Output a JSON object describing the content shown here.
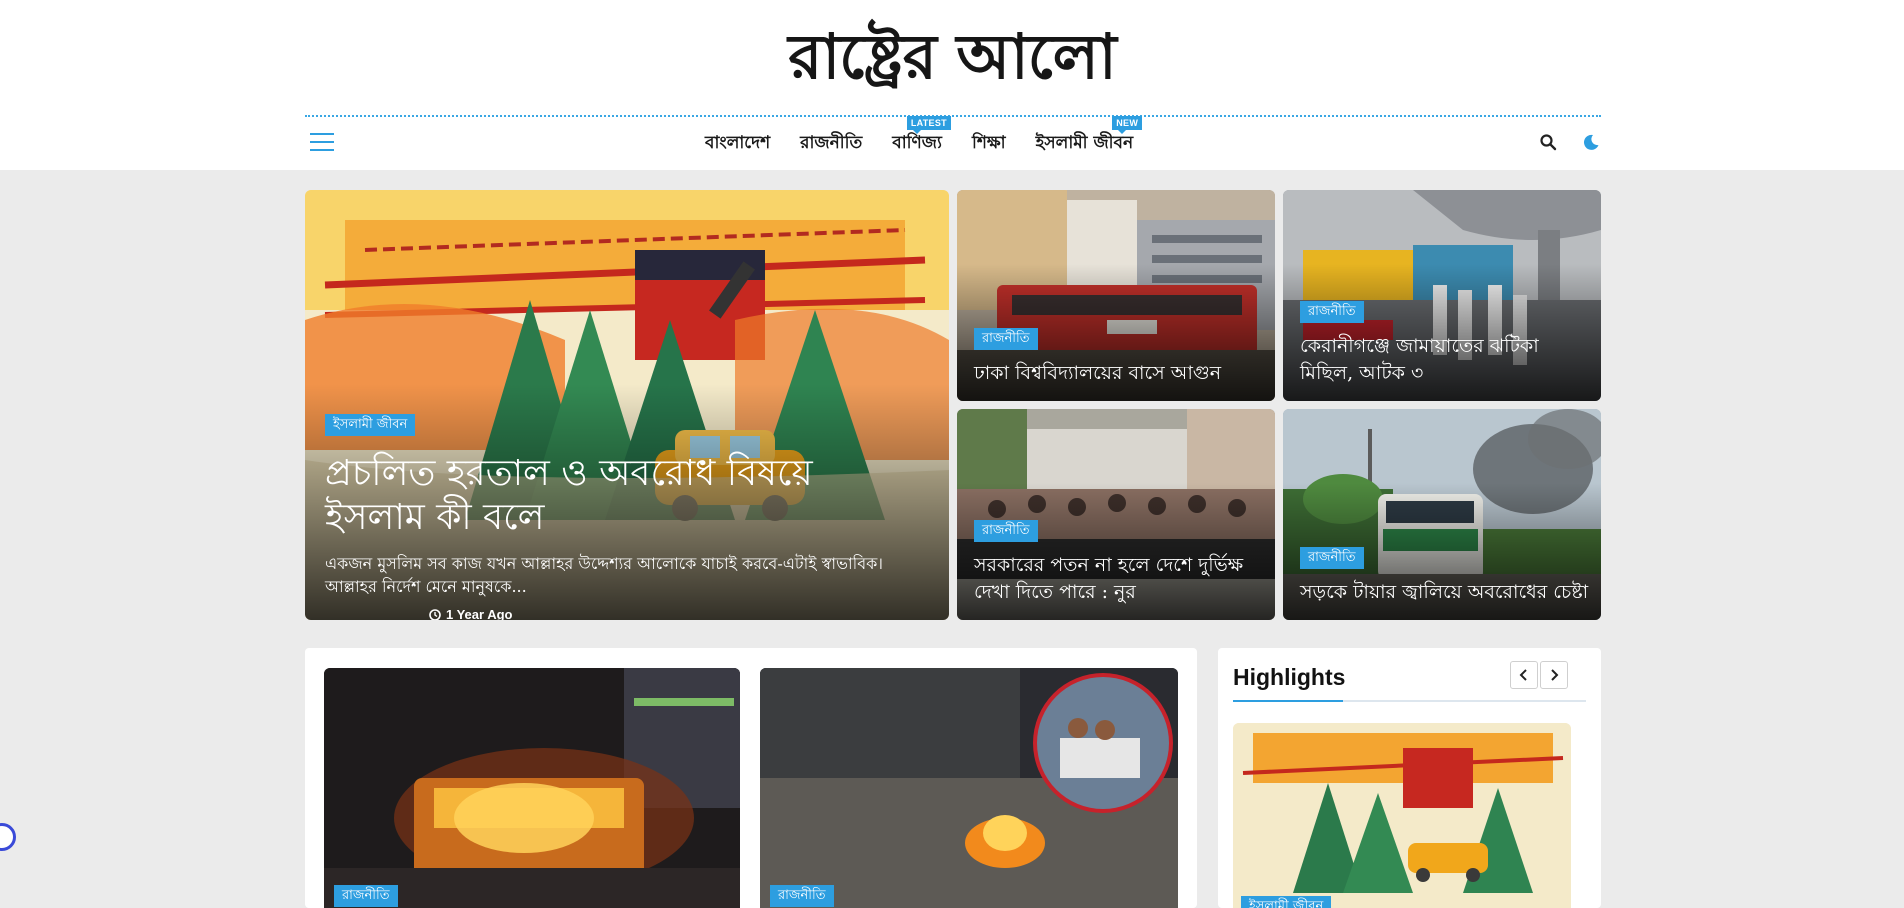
{
  "site": {
    "title": "রাষ্ট্রের আলো"
  },
  "nav": {
    "items": [
      {
        "label": "বাংলাদেশ",
        "badge": ""
      },
      {
        "label": "রাজনীতি",
        "badge": ""
      },
      {
        "label": "বাণিজ্য",
        "badge": "LATEST"
      },
      {
        "label": "শিক্ষা",
        "badge": ""
      },
      {
        "label": "ইসলামী জীবন",
        "badge": "NEW"
      }
    ]
  },
  "featured": {
    "main": {
      "category": "ইসলামী জীবন",
      "time": "1 Year Ago",
      "title": "প্রচলিত হরতাল ও অবরোধ বিষয়ে ইসলাম কী বলে",
      "excerpt": "একজন মুসলিম সব কাজ যখন আল্লাহর উদ্দেশ্যর আলোকে যাচাই করবে-এটাই স্বাভাবিক। আল্লাহর নির্দেশ মেনে মানুষকে..."
    },
    "cards": [
      {
        "category": "রাজনীতি",
        "title": "ঢাকা বিশ্ববিদ্যালয়ের বাসে আগুন"
      },
      {
        "category": "রাজনীতি",
        "title": "কেরানীগঞ্জে জামায়াতের ঝটিকা মিছিল, আটক ৩"
      },
      {
        "category": "রাজনীতি",
        "title": "সরকারের পতন না হলে দেশে দুর্ভিক্ষ দেখা দিতে পারে : নুর"
      },
      {
        "category": "রাজনীতি",
        "title": "সড়কে টায়ার জ্বালিয়ে অবরোধের চেষ্টা"
      }
    ]
  },
  "lower": {
    "cards": [
      {
        "category": "রাজনীতি"
      },
      {
        "category": "রাজনীতি"
      }
    ]
  },
  "highlights": {
    "title": "Highlights",
    "card_category": "ইসলামী জীবন"
  },
  "colors": {
    "accent": "#2d9ee0",
    "page_bg": "#ebebeb"
  }
}
